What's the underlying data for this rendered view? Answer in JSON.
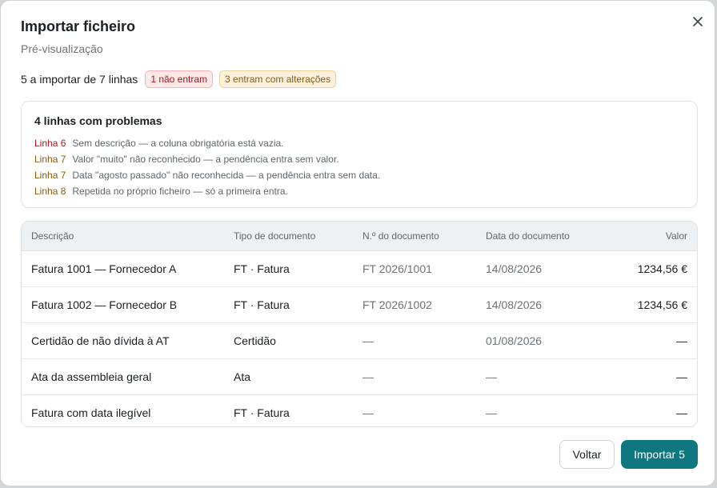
{
  "dialog": {
    "title": "Importar ficheiro",
    "subtitle": "Pré-visualização",
    "close_icon": "close-icon",
    "summary": {
      "text": "5 a importar de 7 linhas",
      "badge_excluded": "1 não entram",
      "badge_altered": "3 entram com alterações"
    },
    "problems": {
      "title": "4 linhas com problemas",
      "items": [
        {
          "line": "Linha 6",
          "message": "Sem descrição — a coluna obrigatória está vazia.",
          "severity": "error"
        },
        {
          "line": "Linha 7",
          "message": "Valor \"muito\" não reconhecido — a pendência entra sem valor.",
          "severity": "warning"
        },
        {
          "line": "Linha 7",
          "message": "Data \"agosto passado\" não reconhecida — a pendência entra sem data.",
          "severity": "warning"
        },
        {
          "line": "Linha 8",
          "message": "Repetida no próprio ficheiro — só a primeira entra.",
          "severity": "warning"
        }
      ]
    },
    "table": {
      "columns": [
        "Descrição",
        "Tipo de documento",
        "N.º do documento",
        "Data do documento",
        "Valor"
      ],
      "rows": [
        [
          "Fatura 1001 — Fornecedor A",
          "FT · Fatura",
          "FT 2026/1001",
          "14/08/2026",
          "1234,56 €"
        ],
        [
          "Fatura 1002 — Fornecedor B",
          "FT · Fatura",
          "FT 2026/1002",
          "14/08/2026",
          "1234,56 €"
        ],
        [
          "Certidão de não dívida à AT",
          "Certidão",
          "—",
          "01/08/2026",
          "—"
        ],
        [
          "Ata da assembleia geral",
          "Ata",
          "—",
          "—",
          "—"
        ],
        [
          "Fatura com data ilegível",
          "FT · Fatura",
          "—",
          "—",
          "—"
        ]
      ]
    },
    "buttons": {
      "back": "Voltar",
      "import": "Importar 5"
    },
    "colors": {
      "accent": "#0e7680",
      "error": "#b3141b",
      "warning": "#8a5a0b"
    }
  }
}
